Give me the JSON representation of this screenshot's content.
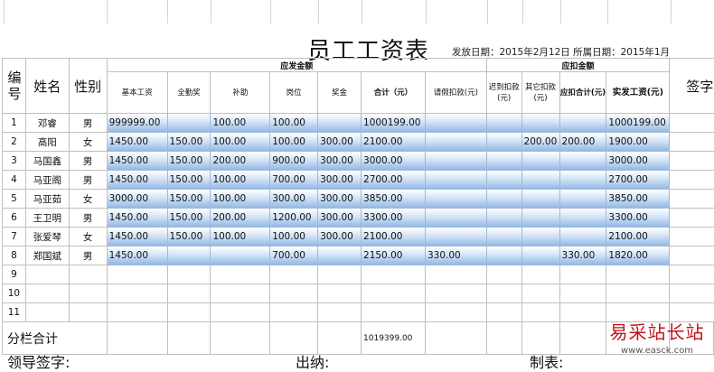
{
  "title": "员工工资表",
  "issue_date": "发放日期：2015年2月12日 所属日期：2015年1月",
  "headers": {
    "no": "编号",
    "name": "姓名",
    "gender": "性别",
    "payable_group": "应发金额",
    "deduct_group": "应扣金额",
    "base": "基本工资",
    "attendance": "全勤奖",
    "subsidy": "补助",
    "post": "岗位",
    "bonus": "奖金",
    "subtotal": "合计（元）",
    "leave": "请假扣款(元)",
    "late": "迟到扣款(元)",
    "other": "其它扣款(元)",
    "deduct_total": "应扣合计(元)",
    "net": "实发工资(元)",
    "sign": "签字"
  },
  "rows": [
    {
      "no": "1",
      "name": "邓睿",
      "gender": "男",
      "base": "999999.00",
      "attendance": "",
      "subsidy": "100.00",
      "post": "100.00",
      "bonus": "",
      "subtotal": "1000199.00",
      "leave": "",
      "late": "",
      "other": "",
      "deduct_total": "",
      "net": "1000199.00"
    },
    {
      "no": "2",
      "name": "高阳",
      "gender": "女",
      "base": "1450.00",
      "attendance": "150.00",
      "subsidy": "100.00",
      "post": "100.00",
      "bonus": "300.00",
      "subtotal": "2100.00",
      "leave": "",
      "late": "",
      "other": "200.00",
      "deduct_total": "200.00",
      "net": "1900.00"
    },
    {
      "no": "3",
      "name": "马国鑫",
      "gender": "男",
      "base": "1450.00",
      "attendance": "150.00",
      "subsidy": "200.00",
      "post": "900.00",
      "bonus": "300.00",
      "subtotal": "3000.00",
      "leave": "",
      "late": "",
      "other": "",
      "deduct_total": "",
      "net": "3000.00"
    },
    {
      "no": "4",
      "name": "马亚阁",
      "gender": "男",
      "base": "1450.00",
      "attendance": "150.00",
      "subsidy": "100.00",
      "post": "700.00",
      "bonus": "300.00",
      "subtotal": "2700.00",
      "leave": "",
      "late": "",
      "other": "",
      "deduct_total": "",
      "net": "2700.00"
    },
    {
      "no": "5",
      "name": "马亚茹",
      "gender": "女",
      "base": "3000.00",
      "attendance": "150.00",
      "subsidy": "100.00",
      "post": "300.00",
      "bonus": "300.00",
      "subtotal": "3850.00",
      "leave": "",
      "late": "",
      "other": "",
      "deduct_total": "",
      "net": "3850.00"
    },
    {
      "no": "6",
      "name": "王卫明",
      "gender": "男",
      "base": "1450.00",
      "attendance": "150.00",
      "subsidy": "200.00",
      "post": "1200.00",
      "bonus": "300.00",
      "subtotal": "3300.00",
      "leave": "",
      "late": "",
      "other": "",
      "deduct_total": "",
      "net": "3300.00"
    },
    {
      "no": "7",
      "name": "张爱琴",
      "gender": "女",
      "base": "1450.00",
      "attendance": "150.00",
      "subsidy": "100.00",
      "post": "100.00",
      "bonus": "300.00",
      "subtotal": "2100.00",
      "leave": "",
      "late": "",
      "other": "",
      "deduct_total": "",
      "net": "2100.00"
    },
    {
      "no": "8",
      "name": "郑国斌",
      "gender": "男",
      "base": "1450.00",
      "attendance": "",
      "subsidy": "",
      "post": "700.00",
      "bonus": "",
      "subtotal": "2150.00",
      "leave": "330.00",
      "late": "",
      "other": "",
      "deduct_total": "330.00",
      "net": "1820.00"
    }
  ],
  "empty_rows": [
    "9",
    "10",
    "11"
  ],
  "summary": {
    "label": "分栏合计",
    "subtotal": "1019399.00"
  },
  "footer": {
    "leader": "领导签字:",
    "cashier": "出纳:",
    "maker": "制表:"
  },
  "watermark": {
    "name": "易采站长站",
    "url": "www.easck.com"
  }
}
